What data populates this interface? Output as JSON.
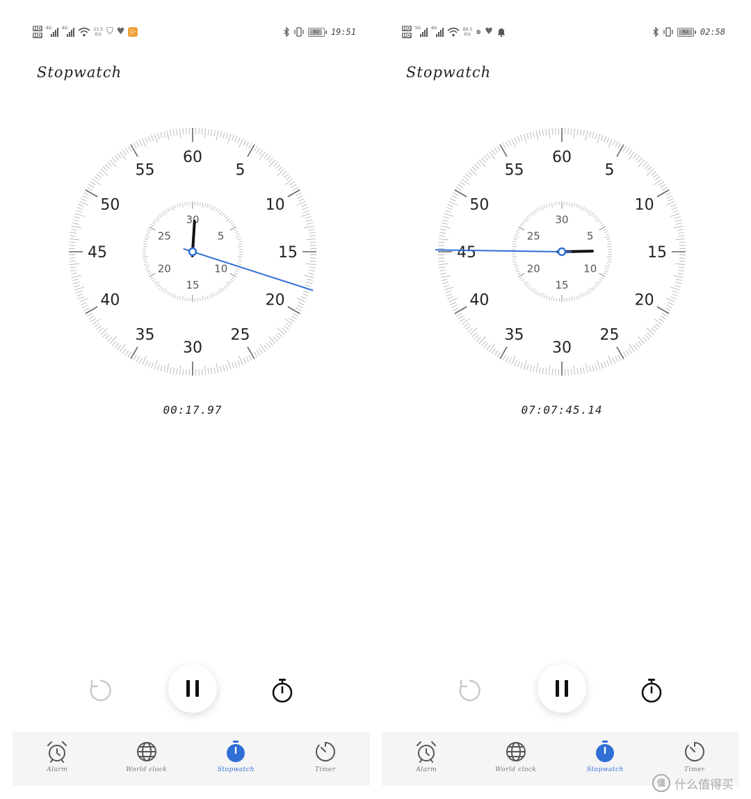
{
  "screens": [
    {
      "status": {
        "speed_value": "21.5",
        "speed_unit": "K/s",
        "battery_pct": "82",
        "time": "19:51"
      },
      "title": "Stopwatch",
      "dial": {
        "outer_labels": [
          "60",
          "5",
          "10",
          "15",
          "20",
          "25",
          "30",
          "35",
          "40",
          "45",
          "50",
          "55"
        ],
        "inner_labels": [
          "30",
          "5",
          "10",
          "15",
          "20",
          "25"
        ],
        "seconds_hand_value": 17.97,
        "minute_hand_value": 0.3
      },
      "readout": "00:17.97",
      "tabs": [
        {
          "label": "Alarm",
          "icon": "alarm-clock-icon"
        },
        {
          "label": "World  clock",
          "icon": "globe-icon"
        },
        {
          "label": "Stopwatch",
          "icon": "stopwatch-icon"
        },
        {
          "label": "Timer",
          "icon": "timer-icon"
        }
      ],
      "active_tab": 2
    },
    {
      "status": {
        "speed_value": "89.3",
        "speed_unit": "K/s",
        "battery_pct": "92",
        "time": "02:58"
      },
      "title": "Stopwatch",
      "dial": {
        "outer_labels": [
          "60",
          "5",
          "10",
          "15",
          "20",
          "25",
          "30",
          "35",
          "40",
          "45",
          "50",
          "55"
        ],
        "inner_labels": [
          "30",
          "5",
          "10",
          "15",
          "20",
          "25"
        ],
        "seconds_hand_value": 45.14,
        "minute_hand_value": 7.4
      },
      "readout": "07:07:45.14",
      "tabs": [
        {
          "label": "Alarm",
          "icon": "alarm-clock-icon"
        },
        {
          "label": "World  clock",
          "icon": "globe-icon"
        },
        {
          "label": "Stopwatch",
          "icon": "stopwatch-icon"
        },
        {
          "label": "Timer",
          "icon": "timer-icon"
        }
      ],
      "active_tab": 2
    }
  ],
  "watermark": "什么值得买",
  "colors": {
    "accent": "#2f6fd6",
    "hand": "#111111",
    "tick": "#bbbbbb",
    "tab_bg": "#f5f5f5"
  }
}
